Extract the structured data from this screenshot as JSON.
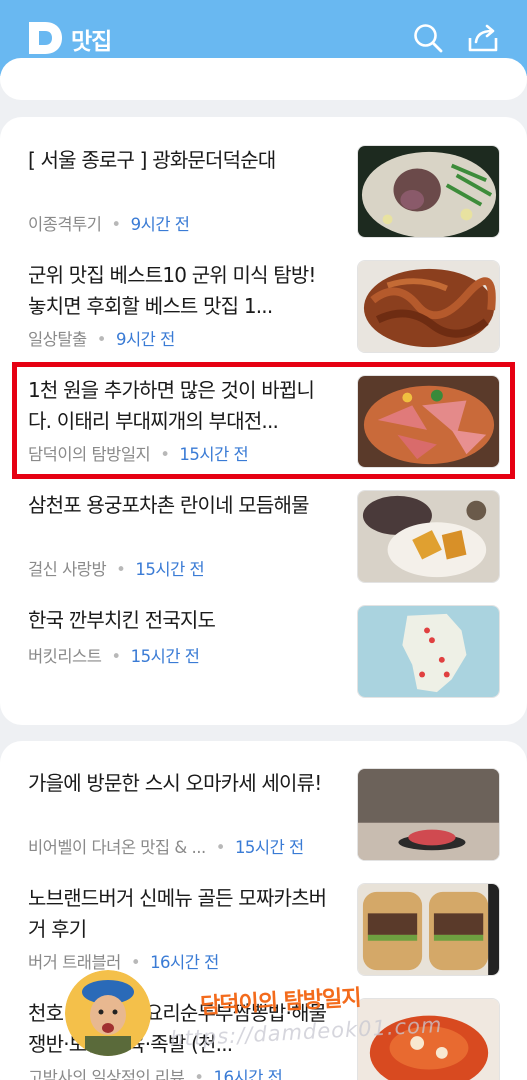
{
  "header": {
    "title": "맛집",
    "bg_color": "#69b8f1"
  },
  "icons": [
    "daum-logo-icon",
    "search-icon",
    "share-icon"
  ],
  "accent_color": "#3a7bd5",
  "highlight_color": "#e60012",
  "articles": [
    {
      "title": "[ 서울 종로구 ] 광화문더덕순대",
      "source": "이종격투기",
      "time": "9시간 전"
    },
    {
      "title": "군위 맛집 베스트10 군위 미식 탐방! 놓치면 후회할 베스트 맛집 1...",
      "source": "일상탈출",
      "time": "9시간 전"
    },
    {
      "title": "1천 원을 추가하면 많은 것이 바뀝니다. 이태리 부대찌개의 부대전...",
      "source": "담덕이의 탐방일지",
      "time": "15시간 전"
    },
    {
      "title": "삼천포 용궁포차촌 란이네 모듬해물",
      "source": "걸신 사랑방",
      "time": "15시간 전"
    },
    {
      "title": "한국 깐부치킨 전국지도",
      "source": "버킷리스트",
      "time": "15시간 전"
    },
    {
      "title": "가을에 방문한 스시 오마카세 세이류!",
      "source": "비어벨이 다녀온 맛집 & ...",
      "time": "15시간 전"
    },
    {
      "title": "노브랜드버거 신메뉴 골든 모짜카츠버거 후기",
      "source": "버거 트래블러",
      "time": "16시간 전"
    },
    {
      "title": "천호 맛집 두부요리순두부짬뽕밥·해물쟁반·보쌈·수육·족발 (천...",
      "source": "고박사의 일상적인 리뷰",
      "time": "16시간 전"
    }
  ],
  "watermark": {
    "name": "담덕이의 탐방일지",
    "url": "https://damdeok01.com"
  }
}
